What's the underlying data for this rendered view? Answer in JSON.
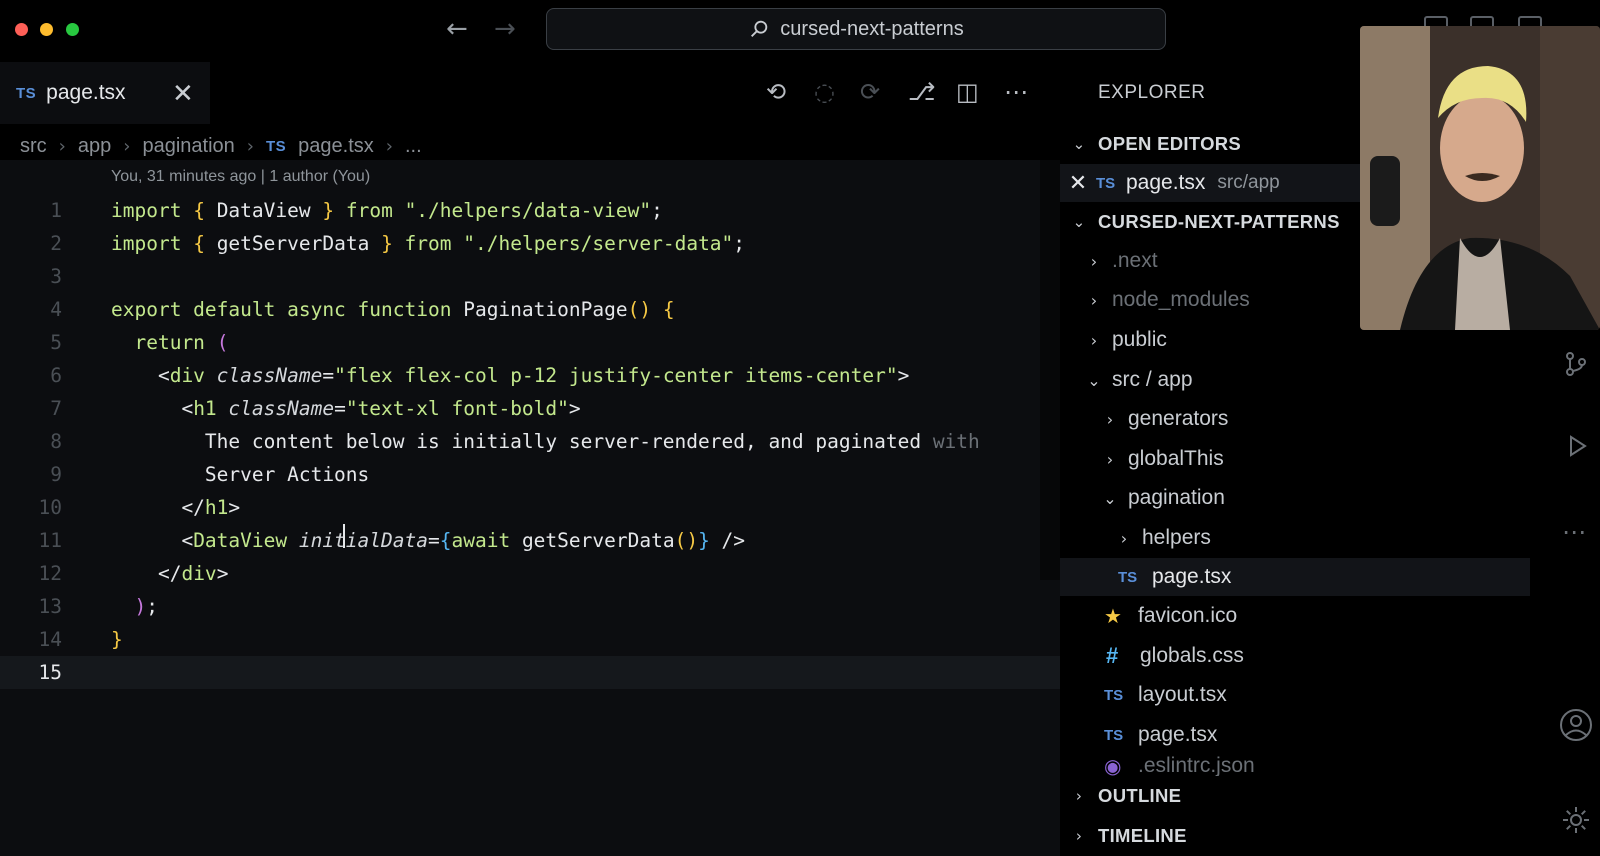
{
  "titlebar": {
    "search_label": "cursed-next-patterns"
  },
  "tab": {
    "badge": "TS",
    "label": "page.tsx"
  },
  "breadcrumbs": [
    "src",
    "app",
    "pagination",
    "page.tsx",
    "..."
  ],
  "breadcrumb_ts_badge": "TS",
  "editor": {
    "blame": "You, 31 minutes ago | 1 author (You)",
    "current_line": 15,
    "line_numbers": [
      "1",
      "2",
      "3",
      "4",
      "5",
      "6",
      "7",
      "8",
      "9",
      "10",
      "11",
      "12",
      "13",
      "14",
      "15"
    ]
  },
  "explorer": {
    "title": "EXPLORER",
    "open_editors_label": "OPEN EDITORS",
    "open_editor": {
      "badge": "TS",
      "name": "page.tsx",
      "path": "src/app"
    },
    "project_label": "CURSED-NEXT-PATTERNS",
    "tree": [
      {
        "name": ".next",
        "kind": "folder",
        "expanded": false,
        "muted": true
      },
      {
        "name": "node_modules",
        "kind": "folder",
        "expanded": false,
        "muted": true
      },
      {
        "name": "public",
        "kind": "folder",
        "expanded": false
      },
      {
        "name": "src / app",
        "kind": "folder",
        "expanded": true
      },
      {
        "name": "generators",
        "kind": "folder",
        "expanded": false
      },
      {
        "name": "globalThis",
        "kind": "folder",
        "expanded": false
      },
      {
        "name": "pagination",
        "kind": "folder",
        "expanded": true
      },
      {
        "name": "helpers",
        "kind": "folder",
        "expanded": false
      },
      {
        "name": "page.tsx",
        "kind": "ts",
        "selected": true,
        "badge": "TS"
      },
      {
        "name": "favicon.ico",
        "kind": "star"
      },
      {
        "name": "globals.css",
        "kind": "css",
        "icon": "#"
      },
      {
        "name": "layout.tsx",
        "kind": "ts",
        "badge": "TS"
      },
      {
        "name": "page.tsx",
        "kind": "ts",
        "badge": "TS"
      },
      {
        "name": ".eslintrc.json",
        "kind": "eslint",
        "muted": true
      }
    ],
    "outline_label": "OUTLINE",
    "timeline_label": "TIMELINE"
  },
  "colors": {
    "keyword": "#c3e88d",
    "string": "#c3e88d",
    "brace_yellow": "#f6c945",
    "brace_purple": "#c678dd",
    "brace_blue": "#56b6f2",
    "ts_badge": "#5a8fd8"
  }
}
